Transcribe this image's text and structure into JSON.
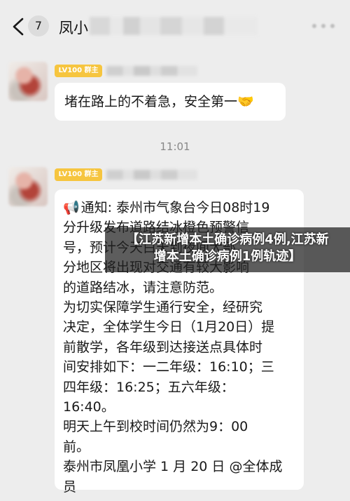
{
  "header": {
    "unread_count": "7",
    "title": "凤小"
  },
  "messages": [
    {
      "level_badge": "LV100 群主",
      "text": "堵在路上的不着急，安全第一",
      "emoji": "🤝"
    },
    {
      "timestamp": "11:01"
    },
    {
      "level_badge": "LV100 群主",
      "emoji": "📢",
      "lines": [
        "通知: 泰州市气象台今日08时19",
        "分升级发布道路结冰橙色预警信",
        "号，预计今天白天到夜间大部",
        "分地区将出现对交通有较大影响",
        "的道路结冰，请注意防范。",
        "为切实保障学生通行安全，经研究",
        "决定，全体学生今日（1月20日）提",
        "前散学，各年级到达接送点具体时",
        "间安排如下：一二年级：16:10；三",
        "四年级：16:25；五六年级：",
        "16:40。",
        "明天上午到校时间仍然为9：00",
        "前。",
        "泰州市凤凰小学 1 月 20 日 @全体成",
        "员"
      ]
    }
  ],
  "overlay_caption": "【江苏新增本土确诊病例4例,江苏新\n增本土确诊病例1例轨迹】",
  "icons": {
    "back": "chevron-left-icon",
    "more": "more-dots-icon",
    "handshake": "handshake-icon",
    "megaphone": "megaphone-icon"
  },
  "colors": {
    "background": "#ededed",
    "bubble": "#ffffff",
    "level_badge": "#f6c53f"
  }
}
